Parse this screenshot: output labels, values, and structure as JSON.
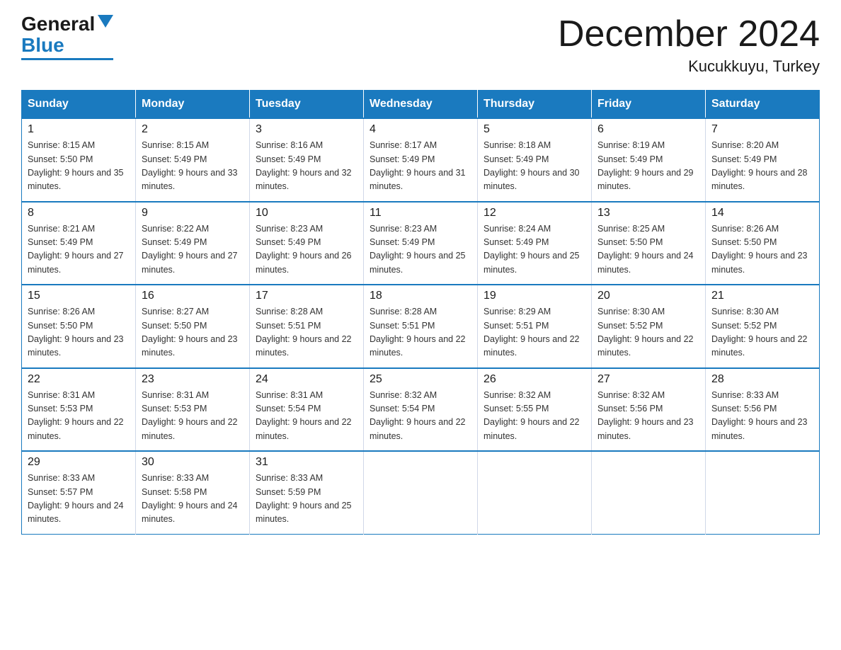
{
  "header": {
    "logo_general": "General",
    "logo_blue": "Blue",
    "month_title": "December 2024",
    "location": "Kucukkuyu, Turkey"
  },
  "days_of_week": [
    "Sunday",
    "Monday",
    "Tuesday",
    "Wednesday",
    "Thursday",
    "Friday",
    "Saturday"
  ],
  "weeks": [
    [
      {
        "day": 1,
        "sunrise": "8:15 AM",
        "sunset": "5:50 PM",
        "daylight": "9 hours and 35 minutes."
      },
      {
        "day": 2,
        "sunrise": "8:15 AM",
        "sunset": "5:49 PM",
        "daylight": "9 hours and 33 minutes."
      },
      {
        "day": 3,
        "sunrise": "8:16 AM",
        "sunset": "5:49 PM",
        "daylight": "9 hours and 32 minutes."
      },
      {
        "day": 4,
        "sunrise": "8:17 AM",
        "sunset": "5:49 PM",
        "daylight": "9 hours and 31 minutes."
      },
      {
        "day": 5,
        "sunrise": "8:18 AM",
        "sunset": "5:49 PM",
        "daylight": "9 hours and 30 minutes."
      },
      {
        "day": 6,
        "sunrise": "8:19 AM",
        "sunset": "5:49 PM",
        "daylight": "9 hours and 29 minutes."
      },
      {
        "day": 7,
        "sunrise": "8:20 AM",
        "sunset": "5:49 PM",
        "daylight": "9 hours and 28 minutes."
      }
    ],
    [
      {
        "day": 8,
        "sunrise": "8:21 AM",
        "sunset": "5:49 PM",
        "daylight": "9 hours and 27 minutes."
      },
      {
        "day": 9,
        "sunrise": "8:22 AM",
        "sunset": "5:49 PM",
        "daylight": "9 hours and 27 minutes."
      },
      {
        "day": 10,
        "sunrise": "8:23 AM",
        "sunset": "5:49 PM",
        "daylight": "9 hours and 26 minutes."
      },
      {
        "day": 11,
        "sunrise": "8:23 AM",
        "sunset": "5:49 PM",
        "daylight": "9 hours and 25 minutes."
      },
      {
        "day": 12,
        "sunrise": "8:24 AM",
        "sunset": "5:49 PM",
        "daylight": "9 hours and 25 minutes."
      },
      {
        "day": 13,
        "sunrise": "8:25 AM",
        "sunset": "5:50 PM",
        "daylight": "9 hours and 24 minutes."
      },
      {
        "day": 14,
        "sunrise": "8:26 AM",
        "sunset": "5:50 PM",
        "daylight": "9 hours and 23 minutes."
      }
    ],
    [
      {
        "day": 15,
        "sunrise": "8:26 AM",
        "sunset": "5:50 PM",
        "daylight": "9 hours and 23 minutes."
      },
      {
        "day": 16,
        "sunrise": "8:27 AM",
        "sunset": "5:50 PM",
        "daylight": "9 hours and 23 minutes."
      },
      {
        "day": 17,
        "sunrise": "8:28 AM",
        "sunset": "5:51 PM",
        "daylight": "9 hours and 22 minutes."
      },
      {
        "day": 18,
        "sunrise": "8:28 AM",
        "sunset": "5:51 PM",
        "daylight": "9 hours and 22 minutes."
      },
      {
        "day": 19,
        "sunrise": "8:29 AM",
        "sunset": "5:51 PM",
        "daylight": "9 hours and 22 minutes."
      },
      {
        "day": 20,
        "sunrise": "8:30 AM",
        "sunset": "5:52 PM",
        "daylight": "9 hours and 22 minutes."
      },
      {
        "day": 21,
        "sunrise": "8:30 AM",
        "sunset": "5:52 PM",
        "daylight": "9 hours and 22 minutes."
      }
    ],
    [
      {
        "day": 22,
        "sunrise": "8:31 AM",
        "sunset": "5:53 PM",
        "daylight": "9 hours and 22 minutes."
      },
      {
        "day": 23,
        "sunrise": "8:31 AM",
        "sunset": "5:53 PM",
        "daylight": "9 hours and 22 minutes."
      },
      {
        "day": 24,
        "sunrise": "8:31 AM",
        "sunset": "5:54 PM",
        "daylight": "9 hours and 22 minutes."
      },
      {
        "day": 25,
        "sunrise": "8:32 AM",
        "sunset": "5:54 PM",
        "daylight": "9 hours and 22 minutes."
      },
      {
        "day": 26,
        "sunrise": "8:32 AM",
        "sunset": "5:55 PM",
        "daylight": "9 hours and 22 minutes."
      },
      {
        "day": 27,
        "sunrise": "8:32 AM",
        "sunset": "5:56 PM",
        "daylight": "9 hours and 23 minutes."
      },
      {
        "day": 28,
        "sunrise": "8:33 AM",
        "sunset": "5:56 PM",
        "daylight": "9 hours and 23 minutes."
      }
    ],
    [
      {
        "day": 29,
        "sunrise": "8:33 AM",
        "sunset": "5:57 PM",
        "daylight": "9 hours and 24 minutes."
      },
      {
        "day": 30,
        "sunrise": "8:33 AM",
        "sunset": "5:58 PM",
        "daylight": "9 hours and 24 minutes."
      },
      {
        "day": 31,
        "sunrise": "8:33 AM",
        "sunset": "5:59 PM",
        "daylight": "9 hours and 25 minutes."
      },
      null,
      null,
      null,
      null
    ]
  ]
}
